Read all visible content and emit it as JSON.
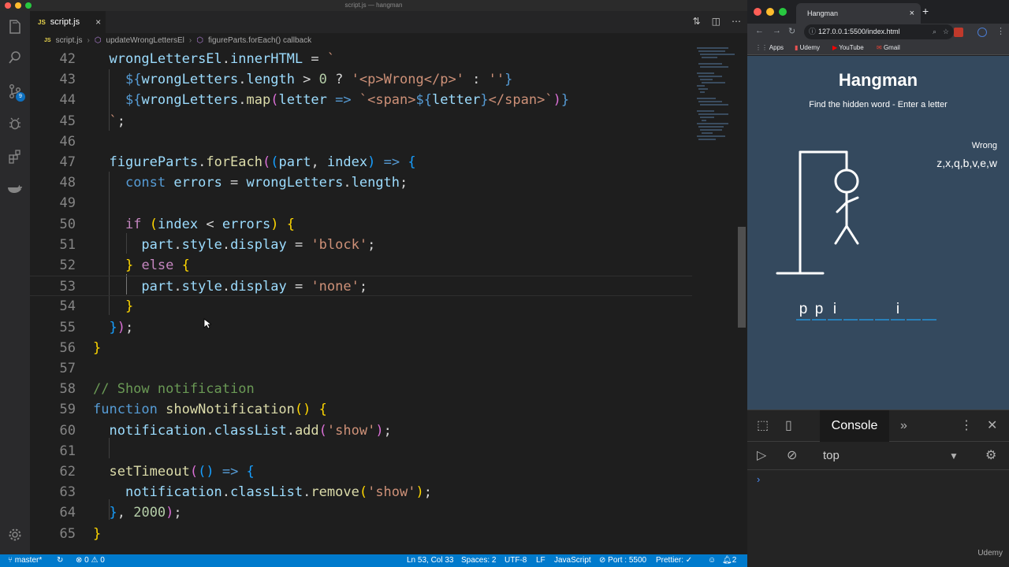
{
  "vscode": {
    "window_title": "script.js — hangman",
    "tab": {
      "label": "script.js",
      "lang_badge": "JS",
      "close": "×"
    },
    "breadcrumb": {
      "file": "script.js",
      "fn": "updateWrongLettersEl",
      "callback": "figureParts.forEach() callback"
    },
    "activity_badge": "9",
    "status": {
      "branch": "master*",
      "errors": "⊗ 0 ⚠ 0",
      "position": "Ln 53, Col 33",
      "spaces": "Spaces: 2",
      "encoding": "UTF-8",
      "eol": "LF",
      "language": "JavaScript",
      "port": "⊘ Port : 5500",
      "prettier": "Prettier: ✓",
      "notifications": "2"
    },
    "lines": [
      {
        "n": "42",
        "tokens": [
          [
            "  ",
            "t-op"
          ],
          [
            "wrongLettersEl",
            "t-var"
          ],
          [
            ".",
            "t-op"
          ],
          [
            "innerHTML",
            "t-var"
          ],
          [
            " = ",
            "t-op"
          ],
          [
            "`",
            "t-str"
          ]
        ]
      },
      {
        "n": "43",
        "tokens": [
          [
            "    ",
            "t-op"
          ],
          [
            "${",
            "t-kw2"
          ],
          [
            "wrongLetters",
            "t-var"
          ],
          [
            ".",
            "t-op"
          ],
          [
            "length",
            "t-var"
          ],
          [
            " > ",
            "t-op"
          ],
          [
            "0",
            "t-num"
          ],
          [
            " ? ",
            "t-op"
          ],
          [
            "'<p>Wrong</p>'",
            "t-str"
          ],
          [
            " : ",
            "t-op"
          ],
          [
            "''",
            "t-str"
          ],
          [
            "}",
            "t-kw2"
          ]
        ]
      },
      {
        "n": "44",
        "tokens": [
          [
            "    ",
            "t-op"
          ],
          [
            "${",
            "t-kw2"
          ],
          [
            "wrongLetters",
            "t-var"
          ],
          [
            ".",
            "t-op"
          ],
          [
            "map",
            "t-fn"
          ],
          [
            "(",
            "t-br2"
          ],
          [
            "letter",
            "t-var"
          ],
          [
            " => ",
            "t-kw2"
          ],
          [
            "`<span>",
            "t-str"
          ],
          [
            "${",
            "t-kw2"
          ],
          [
            "letter",
            "t-var"
          ],
          [
            "}",
            "t-kw2"
          ],
          [
            "</span>`",
            "t-str"
          ],
          [
            ")",
            "t-br2"
          ],
          [
            "}",
            "t-kw2"
          ]
        ]
      },
      {
        "n": "45",
        "tokens": [
          [
            "  ",
            "t-op"
          ],
          [
            "`",
            "t-str"
          ],
          [
            ";",
            "t-op"
          ]
        ]
      },
      {
        "n": "46",
        "tokens": []
      },
      {
        "n": "47",
        "tokens": [
          [
            "  ",
            "t-op"
          ],
          [
            "figureParts",
            "t-var"
          ],
          [
            ".",
            "t-op"
          ],
          [
            "forEach",
            "t-fn"
          ],
          [
            "(",
            "t-br2"
          ],
          [
            "(",
            "t-br3"
          ],
          [
            "part",
            "t-var"
          ],
          [
            ", ",
            "t-op"
          ],
          [
            "index",
            "t-var"
          ],
          [
            ")",
            "t-br3"
          ],
          [
            " => ",
            "t-kw2"
          ],
          [
            "{",
            "t-br3"
          ]
        ]
      },
      {
        "n": "48",
        "tokens": [
          [
            "    ",
            "t-op"
          ],
          [
            "const",
            "t-kw2"
          ],
          [
            " ",
            "t-op"
          ],
          [
            "errors",
            "t-var"
          ],
          [
            " = ",
            "t-op"
          ],
          [
            "wrongLetters",
            "t-var"
          ],
          [
            ".",
            "t-op"
          ],
          [
            "length",
            "t-var"
          ],
          [
            ";",
            "t-op"
          ]
        ]
      },
      {
        "n": "49",
        "tokens": []
      },
      {
        "n": "50",
        "tokens": [
          [
            "    ",
            "t-op"
          ],
          [
            "if",
            "t-kw"
          ],
          [
            " ",
            "t-op"
          ],
          [
            "(",
            "t-br1"
          ],
          [
            "index",
            "t-var"
          ],
          [
            " < ",
            "t-op"
          ],
          [
            "errors",
            "t-var"
          ],
          [
            ")",
            "t-br1"
          ],
          [
            " ",
            "t-op"
          ],
          [
            "{",
            "t-br1"
          ]
        ]
      },
      {
        "n": "51",
        "tokens": [
          [
            "      ",
            "t-op"
          ],
          [
            "part",
            "t-var"
          ],
          [
            ".",
            "t-op"
          ],
          [
            "style",
            "t-var"
          ],
          [
            ".",
            "t-op"
          ],
          [
            "display",
            "t-var"
          ],
          [
            " = ",
            "t-op"
          ],
          [
            "'block'",
            "t-str"
          ],
          [
            ";",
            "t-op"
          ]
        ]
      },
      {
        "n": "52",
        "tokens": [
          [
            "    ",
            "t-op"
          ],
          [
            "}",
            "t-br1"
          ],
          [
            " ",
            "t-op"
          ],
          [
            "else",
            "t-kw"
          ],
          [
            " ",
            "t-op"
          ],
          [
            "{",
            "t-br1"
          ]
        ]
      },
      {
        "n": "53",
        "tokens": [
          [
            "      ",
            "t-op"
          ],
          [
            "part",
            "t-var"
          ],
          [
            ".",
            "t-op"
          ],
          [
            "style",
            "t-var"
          ],
          [
            ".",
            "t-op"
          ],
          [
            "display",
            "t-var"
          ],
          [
            " = ",
            "t-op"
          ],
          [
            "'none'",
            "t-str"
          ],
          [
            ";",
            "t-op"
          ]
        ]
      },
      {
        "n": "54",
        "tokens": [
          [
            "    ",
            "t-op"
          ],
          [
            "}",
            "t-br1"
          ]
        ]
      },
      {
        "n": "55",
        "tokens": [
          [
            "  ",
            "t-op"
          ],
          [
            "}",
            "t-br3"
          ],
          [
            ")",
            "t-br2"
          ],
          [
            ";",
            "t-op"
          ]
        ]
      },
      {
        "n": "56",
        "tokens": [
          [
            "}",
            "t-br1"
          ]
        ]
      },
      {
        "n": "57",
        "tokens": []
      },
      {
        "n": "58",
        "tokens": [
          [
            "// Show notification",
            "t-cmt"
          ]
        ]
      },
      {
        "n": "59",
        "tokens": [
          [
            "function",
            "t-kw2"
          ],
          [
            " ",
            "t-op"
          ],
          [
            "showNotification",
            "t-fn"
          ],
          [
            "(",
            "t-br1"
          ],
          [
            ")",
            "t-br1"
          ],
          [
            " ",
            "t-op"
          ],
          [
            "{",
            "t-br1"
          ]
        ]
      },
      {
        "n": "60",
        "tokens": [
          [
            "  ",
            "t-op"
          ],
          [
            "notification",
            "t-var"
          ],
          [
            ".",
            "t-op"
          ],
          [
            "classList",
            "t-var"
          ],
          [
            ".",
            "t-op"
          ],
          [
            "add",
            "t-fn"
          ],
          [
            "(",
            "t-br2"
          ],
          [
            "'show'",
            "t-str"
          ],
          [
            ")",
            "t-br2"
          ],
          [
            ";",
            "t-op"
          ]
        ]
      },
      {
        "n": "61",
        "tokens": []
      },
      {
        "n": "62",
        "tokens": [
          [
            "  ",
            "t-op"
          ],
          [
            "setTimeout",
            "t-fn"
          ],
          [
            "(",
            "t-br2"
          ],
          [
            "(",
            "t-br3"
          ],
          [
            ")",
            "t-br3"
          ],
          [
            " => ",
            "t-kw2"
          ],
          [
            "{",
            "t-br3"
          ]
        ]
      },
      {
        "n": "63",
        "tokens": [
          [
            "    ",
            "t-op"
          ],
          [
            "notification",
            "t-var"
          ],
          [
            ".",
            "t-op"
          ],
          [
            "classList",
            "t-var"
          ],
          [
            ".",
            "t-op"
          ],
          [
            "remove",
            "t-fn"
          ],
          [
            "(",
            "t-br1"
          ],
          [
            "'show'",
            "t-str"
          ],
          [
            ")",
            "t-br1"
          ],
          [
            ";",
            "t-op"
          ]
        ]
      },
      {
        "n": "64",
        "tokens": [
          [
            "  ",
            "t-op"
          ],
          [
            "}",
            "t-br3"
          ],
          [
            ", ",
            "t-op"
          ],
          [
            "2000",
            "t-num"
          ],
          [
            ")",
            "t-br2"
          ],
          [
            ";",
            "t-op"
          ]
        ]
      },
      {
        "n": "65",
        "tokens": [
          [
            "}",
            "t-br1"
          ]
        ]
      }
    ]
  },
  "chrome": {
    "tab_title": "Hangman",
    "tab_close": "×",
    "new_tab": "+",
    "url": "127.0.0.1:5500/index.html",
    "bookmarks": [
      "Apps",
      "Udemy",
      "YouTube",
      "Gmail"
    ],
    "page": {
      "title": "Hangman",
      "subtitle": "Find the hidden word - Enter a letter",
      "wrong_label": "Wrong",
      "wrong_letters": "z,x,q,b,v,e,w",
      "word_letters": [
        "p",
        "p",
        "i",
        "",
        "",
        "",
        "i",
        "",
        ""
      ]
    },
    "devtools": {
      "active_tab": "Console",
      "more": "»",
      "context": "top",
      "prompt": "›"
    },
    "watermark": "Udemy"
  }
}
